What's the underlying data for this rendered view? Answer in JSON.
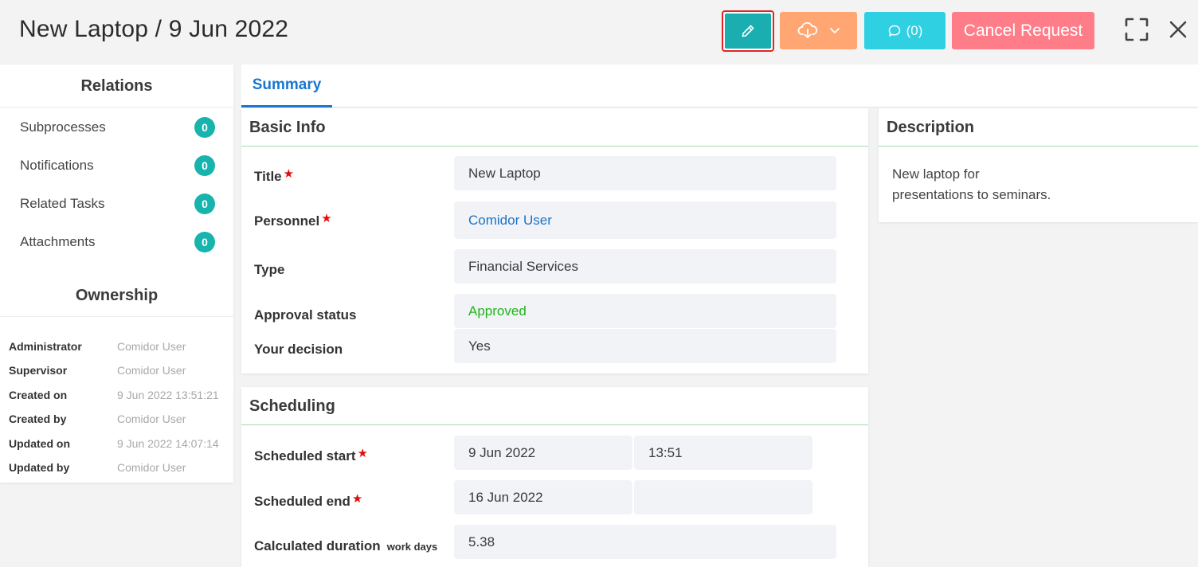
{
  "header": {
    "title": "New Laptop / 9 Jun 2022",
    "comments_label": "(0)",
    "cancel_label": "Cancel Request"
  },
  "colors": {
    "edit": "#1aaeb0",
    "download": "#ffa673",
    "comments": "#2fd0e2",
    "cancel": "#ff7d89",
    "accent": "#1976d2",
    "badge": "#17b3ad",
    "approved": "#21b21e",
    "required": "#e10d0d"
  },
  "relations": {
    "heading": "Relations",
    "items": [
      {
        "label": "Subprocesses",
        "count": "0"
      },
      {
        "label": "Notifications",
        "count": "0"
      },
      {
        "label": "Related Tasks",
        "count": "0"
      },
      {
        "label": "Attachments",
        "count": "0"
      }
    ]
  },
  "ownership": {
    "heading": "Ownership",
    "rows": [
      {
        "label": "Administrator",
        "value": "Comidor User"
      },
      {
        "label": "Supervisor",
        "value": "Comidor User"
      },
      {
        "label": "Created on",
        "value": "9 Jun 2022 13:51:21"
      },
      {
        "label": "Created by",
        "value": "Comidor User"
      },
      {
        "label": "Updated on",
        "value": "9 Jun 2022 14:07:14"
      },
      {
        "label": "Updated by",
        "value": "Comidor User"
      }
    ]
  },
  "tabs": [
    {
      "label": "Summary",
      "active": true
    }
  ],
  "basic_info": {
    "heading": "Basic Info",
    "fields": [
      {
        "label": "Title",
        "value": "New Laptop",
        "required": true
      },
      {
        "label": "Personnel",
        "value": "Comidor User",
        "required": true
      },
      {
        "label": "Type",
        "value": "Financial Services",
        "required": false
      },
      {
        "label": "Approval status",
        "value": "Approved",
        "required": false
      },
      {
        "label": "Your decision",
        "value": "Yes",
        "required": false
      }
    ]
  },
  "scheduling": {
    "heading": "Scheduling",
    "start_label": "Scheduled start",
    "start_date": "9 Jun 2022",
    "start_time": "13:51",
    "end_label": "Scheduled end",
    "end_date": "16 Jun 2022",
    "end_time": "",
    "duration_label": "Calculated duration",
    "duration_unit": "work days",
    "duration_value": "5.38"
  },
  "description": {
    "heading": "Description",
    "line1": "New laptop for",
    "line2": "presentations to seminars."
  },
  "icons": [
    "pencil-icon",
    "cloud-download-icon",
    "chevron-down-icon",
    "comment-icon",
    "expand-icon",
    "close-icon",
    "required-star-icon"
  ]
}
